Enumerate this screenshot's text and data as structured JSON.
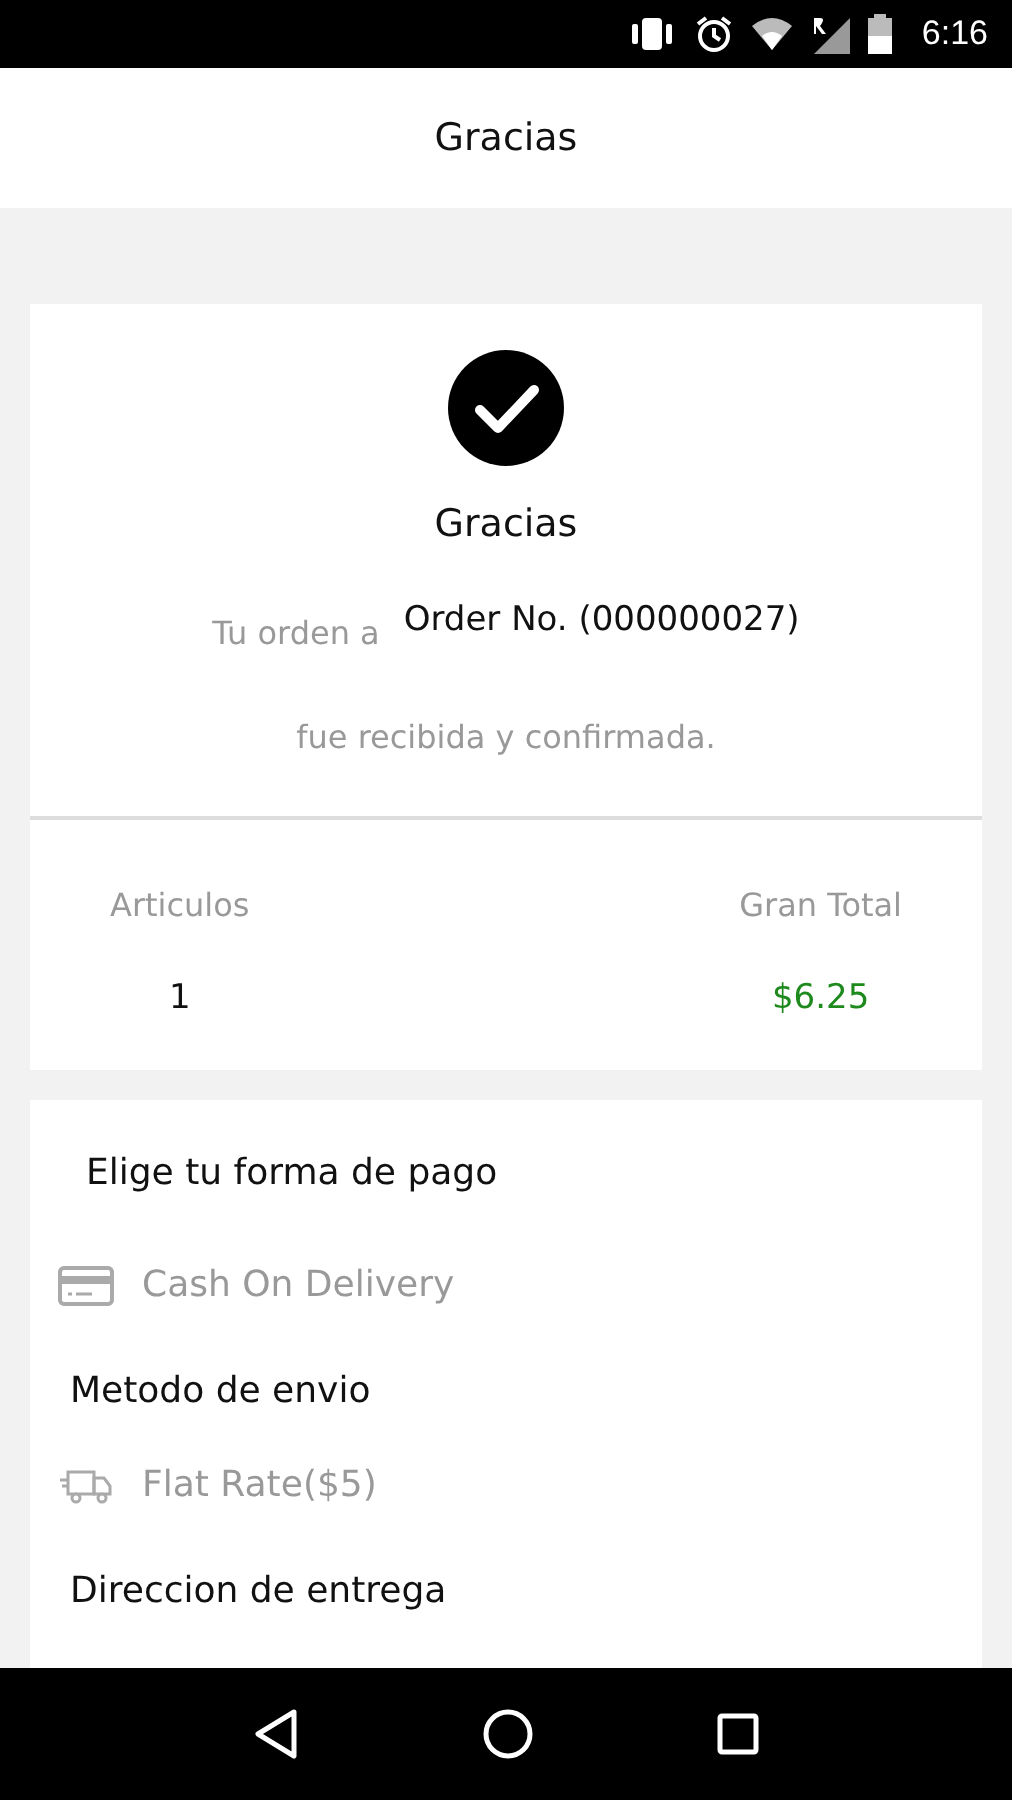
{
  "status_bar": {
    "time": "6:16"
  },
  "app_bar": {
    "title": "Gracias"
  },
  "confirmation": {
    "title": "Gracias",
    "order_prefix": "Tu orden a",
    "order_number": "Order No. (000000027)",
    "message": "fue recibida y confirmada."
  },
  "summary": {
    "items_label": "Articulos",
    "items_value": "1",
    "total_label": "Gran Total",
    "total_value": "$6.25"
  },
  "sections": [
    {
      "heading": "Elige tu forma de pago",
      "value": "Cash On Delivery",
      "kind": "payment"
    },
    {
      "heading": "Metodo de envio",
      "value": "Flat Rate($5)",
      "kind": "shipping"
    },
    {
      "heading": "Direccion de entrega"
    }
  ]
}
